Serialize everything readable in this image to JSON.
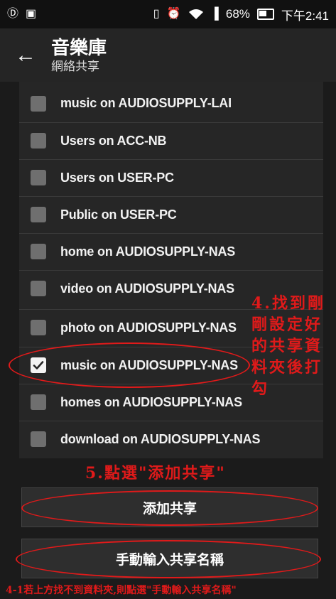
{
  "status_bar": {
    "left_icons": [
      "vpn-key-icon",
      "image-icon"
    ],
    "battery_percent": "68%",
    "time": "下午2:41"
  },
  "app_bar": {
    "title": "音樂庫",
    "subtitle": "網絡共享"
  },
  "shares": [
    {
      "label": "music on AUDIOSUPPLY-LAI",
      "checked": false
    },
    {
      "label": "Users on ACC-NB",
      "checked": false
    },
    {
      "label": "Users on USER-PC",
      "checked": false
    },
    {
      "label": "Public on USER-PC",
      "checked": false
    },
    {
      "label": "home on AUDIOSUPPLY-NAS",
      "checked": false
    },
    {
      "label": "video on AUDIOSUPPLY-NAS",
      "checked": false
    },
    {
      "label": "photo on AUDIOSUPPLY-NAS",
      "checked": false
    },
    {
      "label": "music on AUDIOSUPPLY-NAS",
      "checked": true
    },
    {
      "label": "homes on AUDIOSUPPLY-NAS",
      "checked": false
    },
    {
      "label": "download on AUDIOSUPPLY-NAS",
      "checked": false
    }
  ],
  "buttons": {
    "add_share": "添加共享",
    "manual_share": "手動輸入共享名稱"
  },
  "annotations": {
    "step4_lines": [
      "4.找到剛",
      "剛設定好",
      "的共享資",
      "料夾後打",
      "勾"
    ],
    "step5": "5.點選\"添加共享\"",
    "step4_1": "4-1若上方找不到資料夾,則點選\"手動輸入共享名稱\""
  },
  "colors": {
    "annotation": "#e01a1a",
    "list_background": "#262626"
  }
}
